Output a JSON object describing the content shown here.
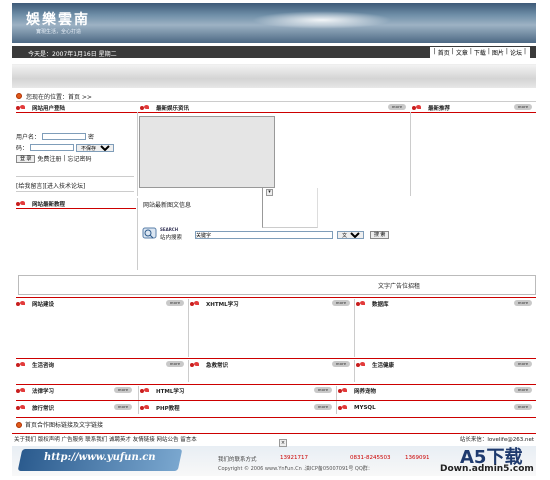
{
  "header": {
    "title": "娛樂雲南",
    "subtitle": "實現生活，全心打造",
    "date": "今天是：2007年1月16日 星期二"
  },
  "topnav": [
    "首页",
    "文章",
    "下载",
    "图片",
    "论坛"
  ],
  "location": "您现在的位置：首页 >>",
  "sections": {
    "login": "网站用户登陆",
    "news": "最新娱乐资讯",
    "recommend": "最新推荐",
    "tutorial": "网站最新教程",
    "web": "网站建设",
    "xhtml": "XHTML学习",
    "db": "数据库",
    "life_consult": "生活咨询",
    "health_knowledge": "急救常识",
    "life_health": "生活健康",
    "law": "法律学习",
    "html": "HTML学习",
    "pet": "网养宠物",
    "travel": "旅行常识",
    "php": "PHP教程",
    "mysql": "MYSQL"
  },
  "more_label": "more",
  "login": {
    "user_label": "用户名：",
    "pwd_label_a": "密",
    "pwd_label_b": "码：",
    "save_option": "不保存",
    "login_btn": "登 录",
    "register": "免费注册",
    "forgot": "忘记密码"
  },
  "forum_link": "[给我留言][进入技术论坛]",
  "tutorial_text": "网站最新图文信息",
  "search": {
    "icon_top": "SEARCH",
    "label": "站内搜索",
    "placeholder": "关键字",
    "scope": "文章",
    "btn": "搜 索"
  },
  "ad_text": "文字广告位招租",
  "links_label": "首页合作图标链接及文字链接",
  "footer": {
    "links": "关于我们  版权声明  广告服务  联系我们  诚聘英才  友情链接  网站公告  留言本",
    "contact": "站长来信：lovelife@263.net"
  },
  "footer_banner": {
    "url": "http://www.yufun.cn",
    "contact": "我们的联系方式",
    "phone": "13921717",
    "phone2": "0831-8245503",
    "phone3": "1369091",
    "copyright": "Copyright © 2006 www.YnFun.Cn .滇ICP备05007091号 QQ群："
  },
  "watermark": {
    "brand": "A5下载",
    "site": "Down.admin5.com"
  }
}
